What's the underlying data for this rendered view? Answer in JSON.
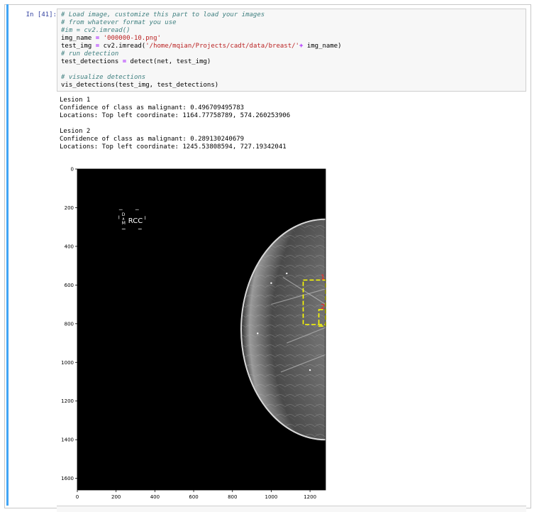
{
  "cell": {
    "prompt": "In [41]:",
    "code_lines": [
      [
        {
          "t": "# Load image, customize this part to load your images",
          "c": "cm"
        }
      ],
      [
        {
          "t": "# from whatever format you use",
          "c": "cm"
        }
      ],
      [
        {
          "t": "#im = cv2.imread()",
          "c": "cm"
        }
      ],
      [
        {
          "t": "img_name ",
          "c": ""
        },
        {
          "t": "=",
          "c": "op"
        },
        {
          "t": " ",
          "c": ""
        },
        {
          "t": "'000000-10.png'",
          "c": "st"
        }
      ],
      [
        {
          "t": "test_img ",
          "c": ""
        },
        {
          "t": "=",
          "c": "op"
        },
        {
          "t": " cv2.imread(",
          "c": ""
        },
        {
          "t": "'/home/mqian/Projects/cadt/data/breast/'",
          "c": "st"
        },
        {
          "t": "+",
          "c": "op"
        },
        {
          "t": " img_name)",
          "c": ""
        }
      ],
      [
        {
          "t": "# run detection",
          "c": "cm"
        }
      ],
      [
        {
          "t": "test_detections ",
          "c": ""
        },
        {
          "t": "=",
          "c": "op"
        },
        {
          "t": " detect(net, test_img)",
          "c": ""
        }
      ],
      [
        {
          "t": "",
          "c": ""
        }
      ],
      [
        {
          "t": "# visualize detections",
          "c": "cm"
        }
      ],
      [
        {
          "t": "vis_detections(test_img, test_detections)",
          "c": ""
        }
      ]
    ]
  },
  "output": {
    "lines": [
      "Lesion 1",
      "Confidence of class as malignant: 0.496709495783",
      "Locations: Top left coordinate: 1164.77758789, 574.260253906",
      "",
      "Lesion 2",
      "Confidence of class as malignant: 0.289130240679",
      "Locations: Top left coordinate: 1245.53808594, 727.19342041"
    ]
  },
  "plot": {
    "x_ticks": [
      "0",
      "200",
      "400",
      "600",
      "800",
      "1000",
      "1200"
    ],
    "y_ticks": [
      "0",
      "200",
      "400",
      "600",
      "800",
      "1000",
      "1200",
      "1400",
      "1600"
    ],
    "x_range": [
      0,
      1280
    ],
    "y_range": [
      0,
      1660
    ],
    "view_label": "RCC",
    "marker_letters": [
      "D",
      "M"
    ],
    "detections": [
      {
        "label": "1",
        "x": 1164.77758789,
        "y": 574.260253906,
        "w": 150,
        "h": 230
      },
      {
        "label": "2",
        "x": 1245.53808594,
        "y": 727.19342041,
        "w": 60,
        "h": 85
      }
    ],
    "box_color": "#ffff00",
    "label_color": "#ff2020"
  }
}
